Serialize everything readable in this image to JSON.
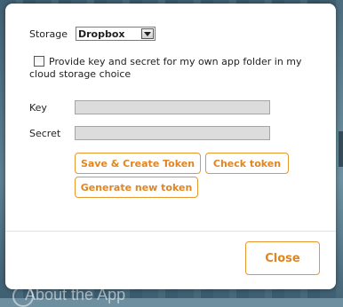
{
  "background": {
    "about_text": "About the App"
  },
  "dialog": {
    "storage_label": "Storage",
    "storage_selected": "Dropbox",
    "own_folder_label": "Provide key and secret for my own app folder in my cloud storage choice",
    "key_label": "Key",
    "key_value": "",
    "secret_label": "Secret",
    "secret_value": "",
    "buttons": {
      "save_create": "Save & Create Token",
      "check": "Check token",
      "generate": "Generate new token"
    },
    "close_label": "Close"
  },
  "colors": {
    "accent": "#e0851f",
    "border_accent": "#e8962e",
    "field_disabled": "#dcdcdc"
  }
}
